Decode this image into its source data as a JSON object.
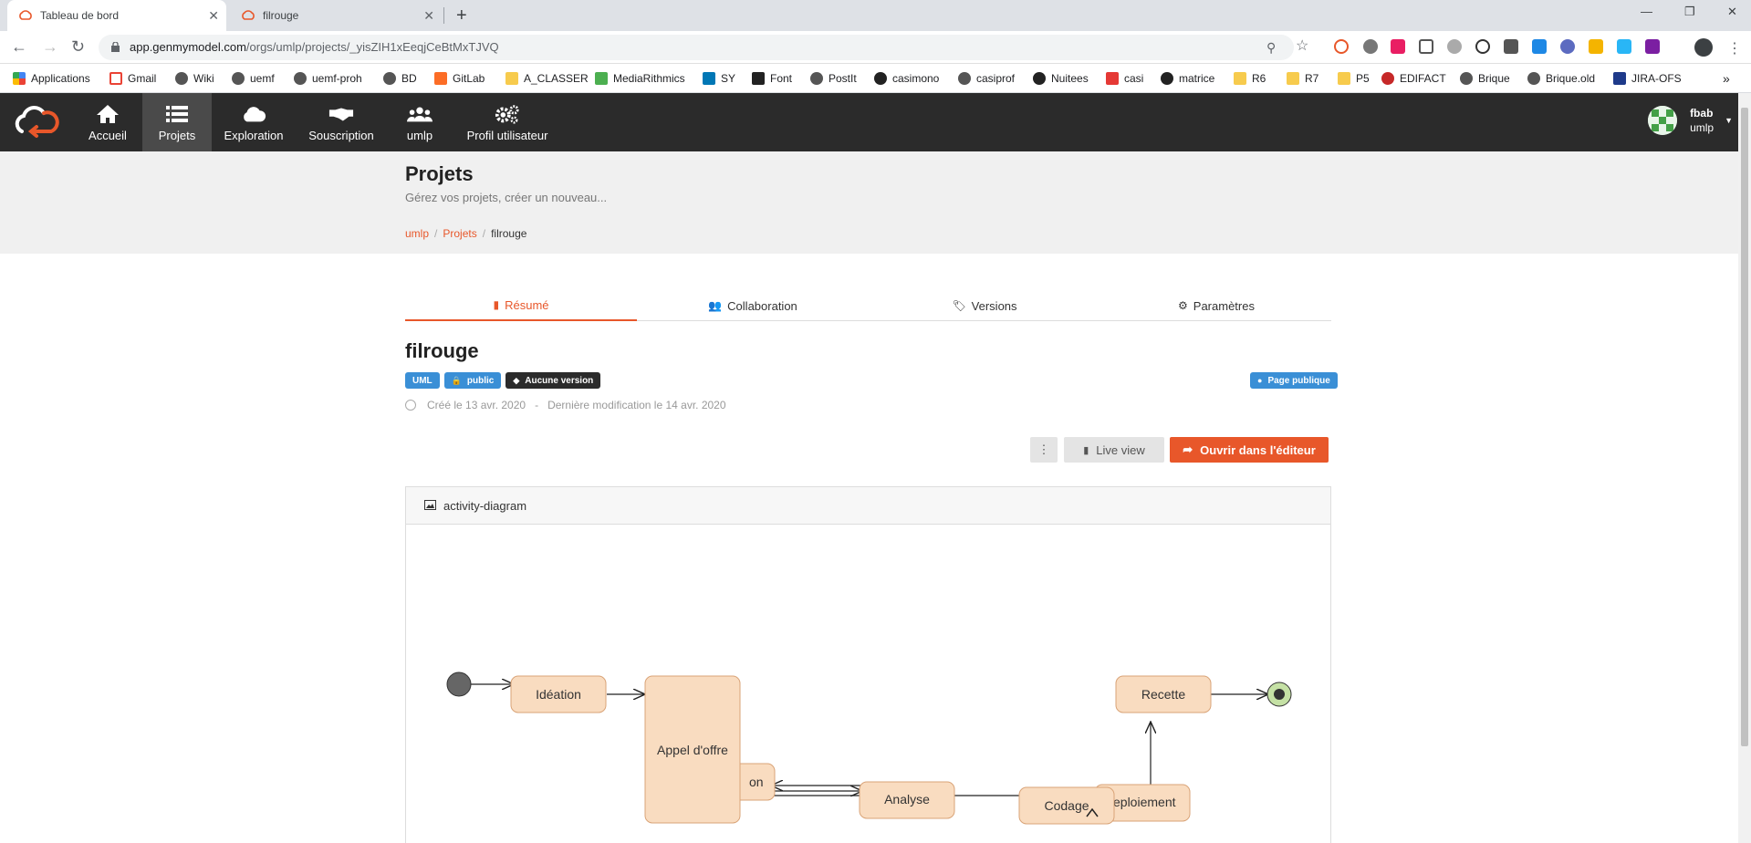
{
  "browser": {
    "tabs": [
      {
        "title": "Tableau de bord",
        "active": true
      },
      {
        "title": "filrouge",
        "active": false
      }
    ],
    "url_host": "app.genmymodel.com",
    "url_path": "/orgs/umlp/projects/_yisZIH1xEeqjCeBtMxTJVQ",
    "bookmarks": [
      "Applications",
      "Gmail",
      "Wiki",
      "uemf",
      "uemf-proh",
      "BD",
      "GitLab",
      "A_CLASSER",
      "MediaRithmics",
      "SY",
      "Font",
      "PostIt",
      "casimono",
      "casiprof",
      "Nuitees",
      "casi",
      "matrice",
      "R6",
      "R7",
      "P5",
      "EDIFACT",
      "Brique",
      "Brique.old",
      "JIRA-OFS"
    ]
  },
  "nav": {
    "items": [
      "Accueil",
      "Projets",
      "Exploration",
      "Souscription",
      "umlp",
      "Profil utilisateur"
    ],
    "active": "Projets",
    "user_name": "fbab",
    "user_org": "umlp"
  },
  "header": {
    "title": "Projets",
    "subtitle": "Gérez vos projets, créer un nouveau...",
    "breadcrumb": [
      "umlp",
      "Projets",
      "filrouge"
    ]
  },
  "project_tabs": [
    "Résumé",
    "Collaboration",
    "Versions",
    "Paramètres"
  ],
  "project": {
    "name": "filrouge",
    "badges": [
      "UML",
      "public",
      "Aucune version"
    ],
    "public_page": "Page publique",
    "created": "Créé le 13 avr. 2020",
    "separator": "-",
    "modified": "Dernière modification le 14 avr. 2020"
  },
  "actions": {
    "live_view": "Live view",
    "open_editor": "Ouvrir dans l'éditeur"
  },
  "diagram": {
    "title": "activity-diagram",
    "nodes": [
      "Idéation",
      "Appel d'offre",
      "on",
      "Analyse",
      "Codage",
      "eploiement",
      "Recette"
    ]
  },
  "colors": {
    "accent": "#e8572a",
    "nav_bg": "#2b2b2b",
    "badge_blue": "#3a8fd6",
    "node_fill": "#f9dcc0",
    "node_stroke": "#d9a377"
  }
}
